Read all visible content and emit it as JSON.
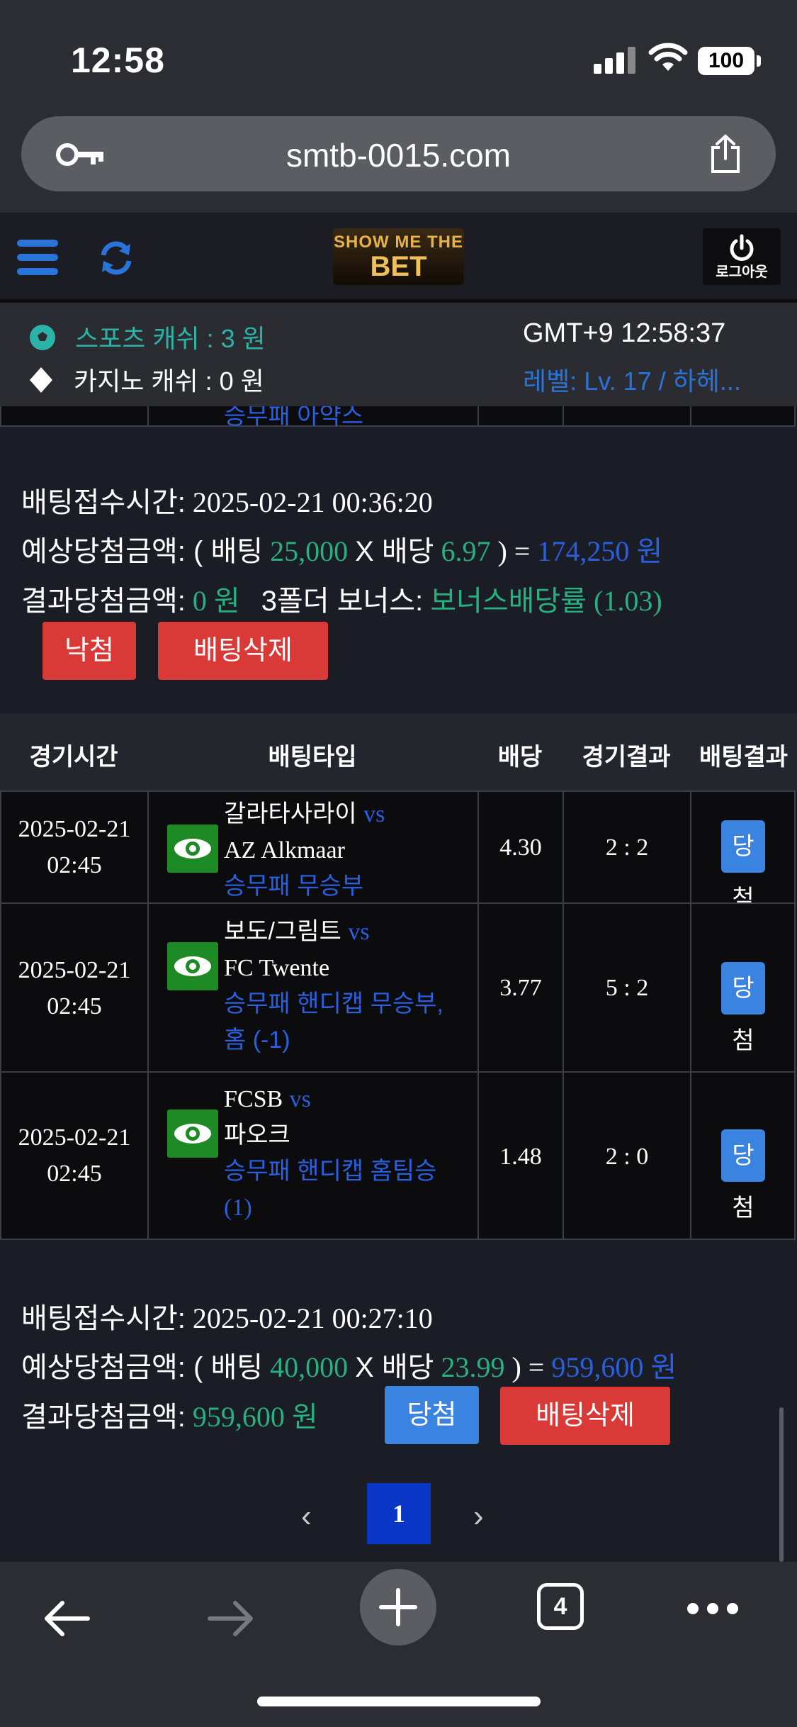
{
  "status": {
    "time": "12:58",
    "battery": "100"
  },
  "browser": {
    "url": "smtb-0015.com",
    "tab_count": "4"
  },
  "header": {
    "logo_top": "SHOW ME THE",
    "logo_main": "BET",
    "logout_label": "로그아웃"
  },
  "info": {
    "sports_cash": "스포츠 캐쉬 :   3 원",
    "casino_cash": "카지노 캐쉬 :   0 원",
    "gmt_time": "GMT+9 12:58:37",
    "level": "레벨: Lv. 17 / 하헤..."
  },
  "top_partial_row": {
    "text": "승무패 아약스"
  },
  "bet1": {
    "receipt_label": "배팅접수시간:",
    "receipt_time": "2025-02-21 00:36:20",
    "expected_label": "예상당첨금액: ( 배팅",
    "stake": "25,000",
    "x_label": "X 배당",
    "odds": "6.97",
    "eq": ") =",
    "expected_amount": "174,250 원",
    "result_label": "결과당첨금액:",
    "result_amount": "0 원",
    "bonus_label": "3폴더 보너스:",
    "bonus_value": "보너스배당률 (1.03)",
    "status_button": "낙첨",
    "delete_button": "배팅삭제"
  },
  "table": {
    "headers": [
      "경기시간",
      "배팅타입",
      "배당",
      "경기결과",
      "배팅결과"
    ],
    "rows": [
      {
        "date": "2025-02-21",
        "time": "02:45",
        "home": "갈라타사라이",
        "vs": "vs",
        "away": "AZ Alkmaar",
        "type1": "승무패 무승부",
        "type2": "",
        "odds": "4.30",
        "score": "2 : 2",
        "result": "당첨"
      },
      {
        "date": "2025-02-21",
        "time": "02:45",
        "home": "보도/그림트",
        "vs": "vs",
        "away": "FC Twente",
        "type1": "승무패 핸디캡 무승부,",
        "type2": "홈 (-1)",
        "odds": "3.77",
        "score": "5 : 2",
        "result": "당첨"
      },
      {
        "date": "2025-02-21",
        "time": "02:45",
        "home": "FCSB",
        "vs": "vs",
        "away": "파오크",
        "type1": "승무패 핸디캡 홈팀승",
        "type2": "(1)",
        "odds": "1.48",
        "score": "2 : 0",
        "result": "당첨"
      }
    ]
  },
  "bet2": {
    "receipt_label": "배팅접수시간:",
    "receipt_time": "2025-02-21 00:27:10",
    "expected_label": "예상당첨금액: ( 배팅",
    "stake": "40,000",
    "x_label": "X 배당",
    "odds": "23.99",
    "eq": ") =",
    "expected_amount": "959,600 원",
    "result_label": "결과당첨금액:",
    "result_amount": "959,600 원",
    "status_button": "당첨",
    "delete_button": "배팅삭제"
  },
  "pager": {
    "prev": "‹",
    "page": "1",
    "next": "›"
  },
  "colors": {
    "accent_green": "#28b17e",
    "accent_blue": "#2a5fe0",
    "button_red": "#d93a38",
    "button_blue": "#3b83e0"
  }
}
